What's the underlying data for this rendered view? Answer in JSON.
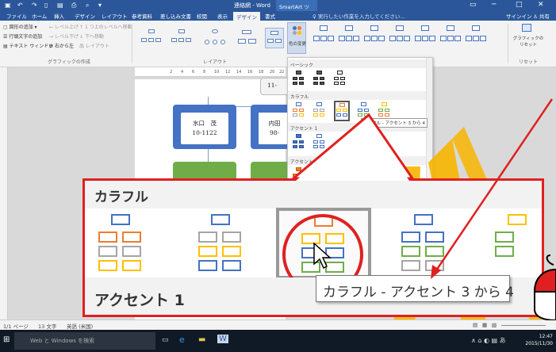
{
  "window": {
    "title": "連絡網 - Word",
    "contextual_tab": "SmartArt ツール",
    "controls": [
      "▭",
      "─",
      "□",
      "✕"
    ]
  },
  "tabs": [
    "ファイル",
    "ホーム",
    "挿入",
    "デザイン",
    "レイアウト",
    "参考資料",
    "差し込み文書",
    "校閲",
    "表示",
    "デザイン",
    "書式"
  ],
  "tellme": "♀ 実行したい作業を入力してください...",
  "signin": "サインイン",
  "share": "共有",
  "ribbon": {
    "create_graphic": {
      "add_shape": "図形の追加",
      "promote": "レベル上げ",
      "move_up": "1 つ上のレベルへ移動",
      "text_pane": "行頭文字の追加",
      "demote": "レベル下げ",
      "move_down": "下へ移動",
      "text_window": "テキスト ウィンドウ",
      "rtl": "右から左",
      "layout_btn": "レイアウト",
      "group_label": "グラフィックの作成"
    },
    "layouts_label": "レイアウト",
    "change_colors": "色の変更",
    "reset_graphic": "グラフィックのリセット",
    "reset_label": "リセット"
  },
  "document": {
    "ruler_marks": [
      "2",
      "4",
      "6",
      "8",
      "10",
      "12",
      "14",
      "16",
      "18",
      "20",
      "22"
    ],
    "top_box_partial": "11-",
    "boxes": [
      {
        "name": "水口　茂",
        "num": "10-1122"
      },
      {
        "name": "内田",
        "num": "98-"
      }
    ]
  },
  "gallery": {
    "sections": [
      "ベーシック",
      "カラフル",
      "アクセント 1",
      "アクセント 2"
    ],
    "tooltip": "カラフル - アクセント 3 から 4"
  },
  "callout": {
    "heading": "カラフル",
    "footer": "アクセント 1",
    "tooltip": "カラフル - アクセント 3 から 4"
  },
  "status": {
    "page": "1/1 ページ",
    "words": "13 文字",
    "lang": "英語 (米国)"
  },
  "taskbar": {
    "search": "Web と Windows を検索",
    "time": "12:47",
    "date": "2015/11/30"
  },
  "colors": {
    "word_blue": "#2b579a",
    "callout_red": "#e02020",
    "org_blue": "#4472c4",
    "org_green": "#70ad47",
    "cursor_orange": "#f7b500"
  }
}
